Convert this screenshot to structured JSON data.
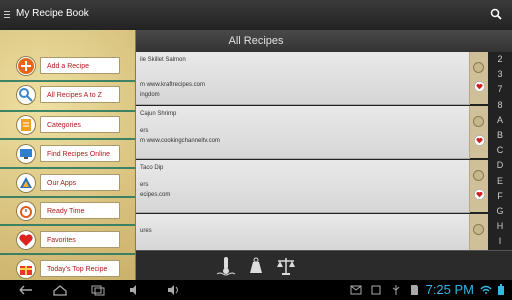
{
  "app": {
    "title": "My Recipe Book"
  },
  "header": {
    "title": "All Recipes"
  },
  "drawer": {
    "items": [
      {
        "label": "Add a Recipe",
        "icon": "plus-icon"
      },
      {
        "label": "All Recipes A to Z",
        "icon": "magnifier-icon"
      },
      {
        "label": "Categories",
        "icon": "notepad-icon"
      },
      {
        "label": "Find Recipes Online",
        "icon": "monitor-icon"
      },
      {
        "label": "Our Apps",
        "icon": "apps-icon"
      },
      {
        "label": "Ready Time",
        "icon": "alarm-clock-icon"
      },
      {
        "label": "Favorites",
        "icon": "heart-icon"
      },
      {
        "label": "Today's Top Recipe",
        "icon": "gift-icon"
      }
    ]
  },
  "recipes": [
    {
      "name": "ile Skillet Salmon",
      "line2": "m www.kraftrecipes.com",
      "line3": "ingdom"
    },
    {
      "name": "Cajun Shrimp",
      "line2": "ers",
      "line3": "m www.cookingchanneltv.com"
    },
    {
      "name": "Taco Dip",
      "line2": "ers",
      "line3": "ecipes.com"
    },
    {
      "name": "",
      "line2": "ures",
      "line3": ""
    }
  ],
  "index": [
    "2",
    "3",
    "7",
    "8",
    "A",
    "B",
    "C",
    "D",
    "E",
    "F",
    "G",
    "H",
    "I"
  ],
  "statusbar": {
    "time": "7:25 PM"
  },
  "colors": {
    "drawer": "#d9c27a",
    "accent": "#b11919",
    "clock": "#33b5e5"
  }
}
